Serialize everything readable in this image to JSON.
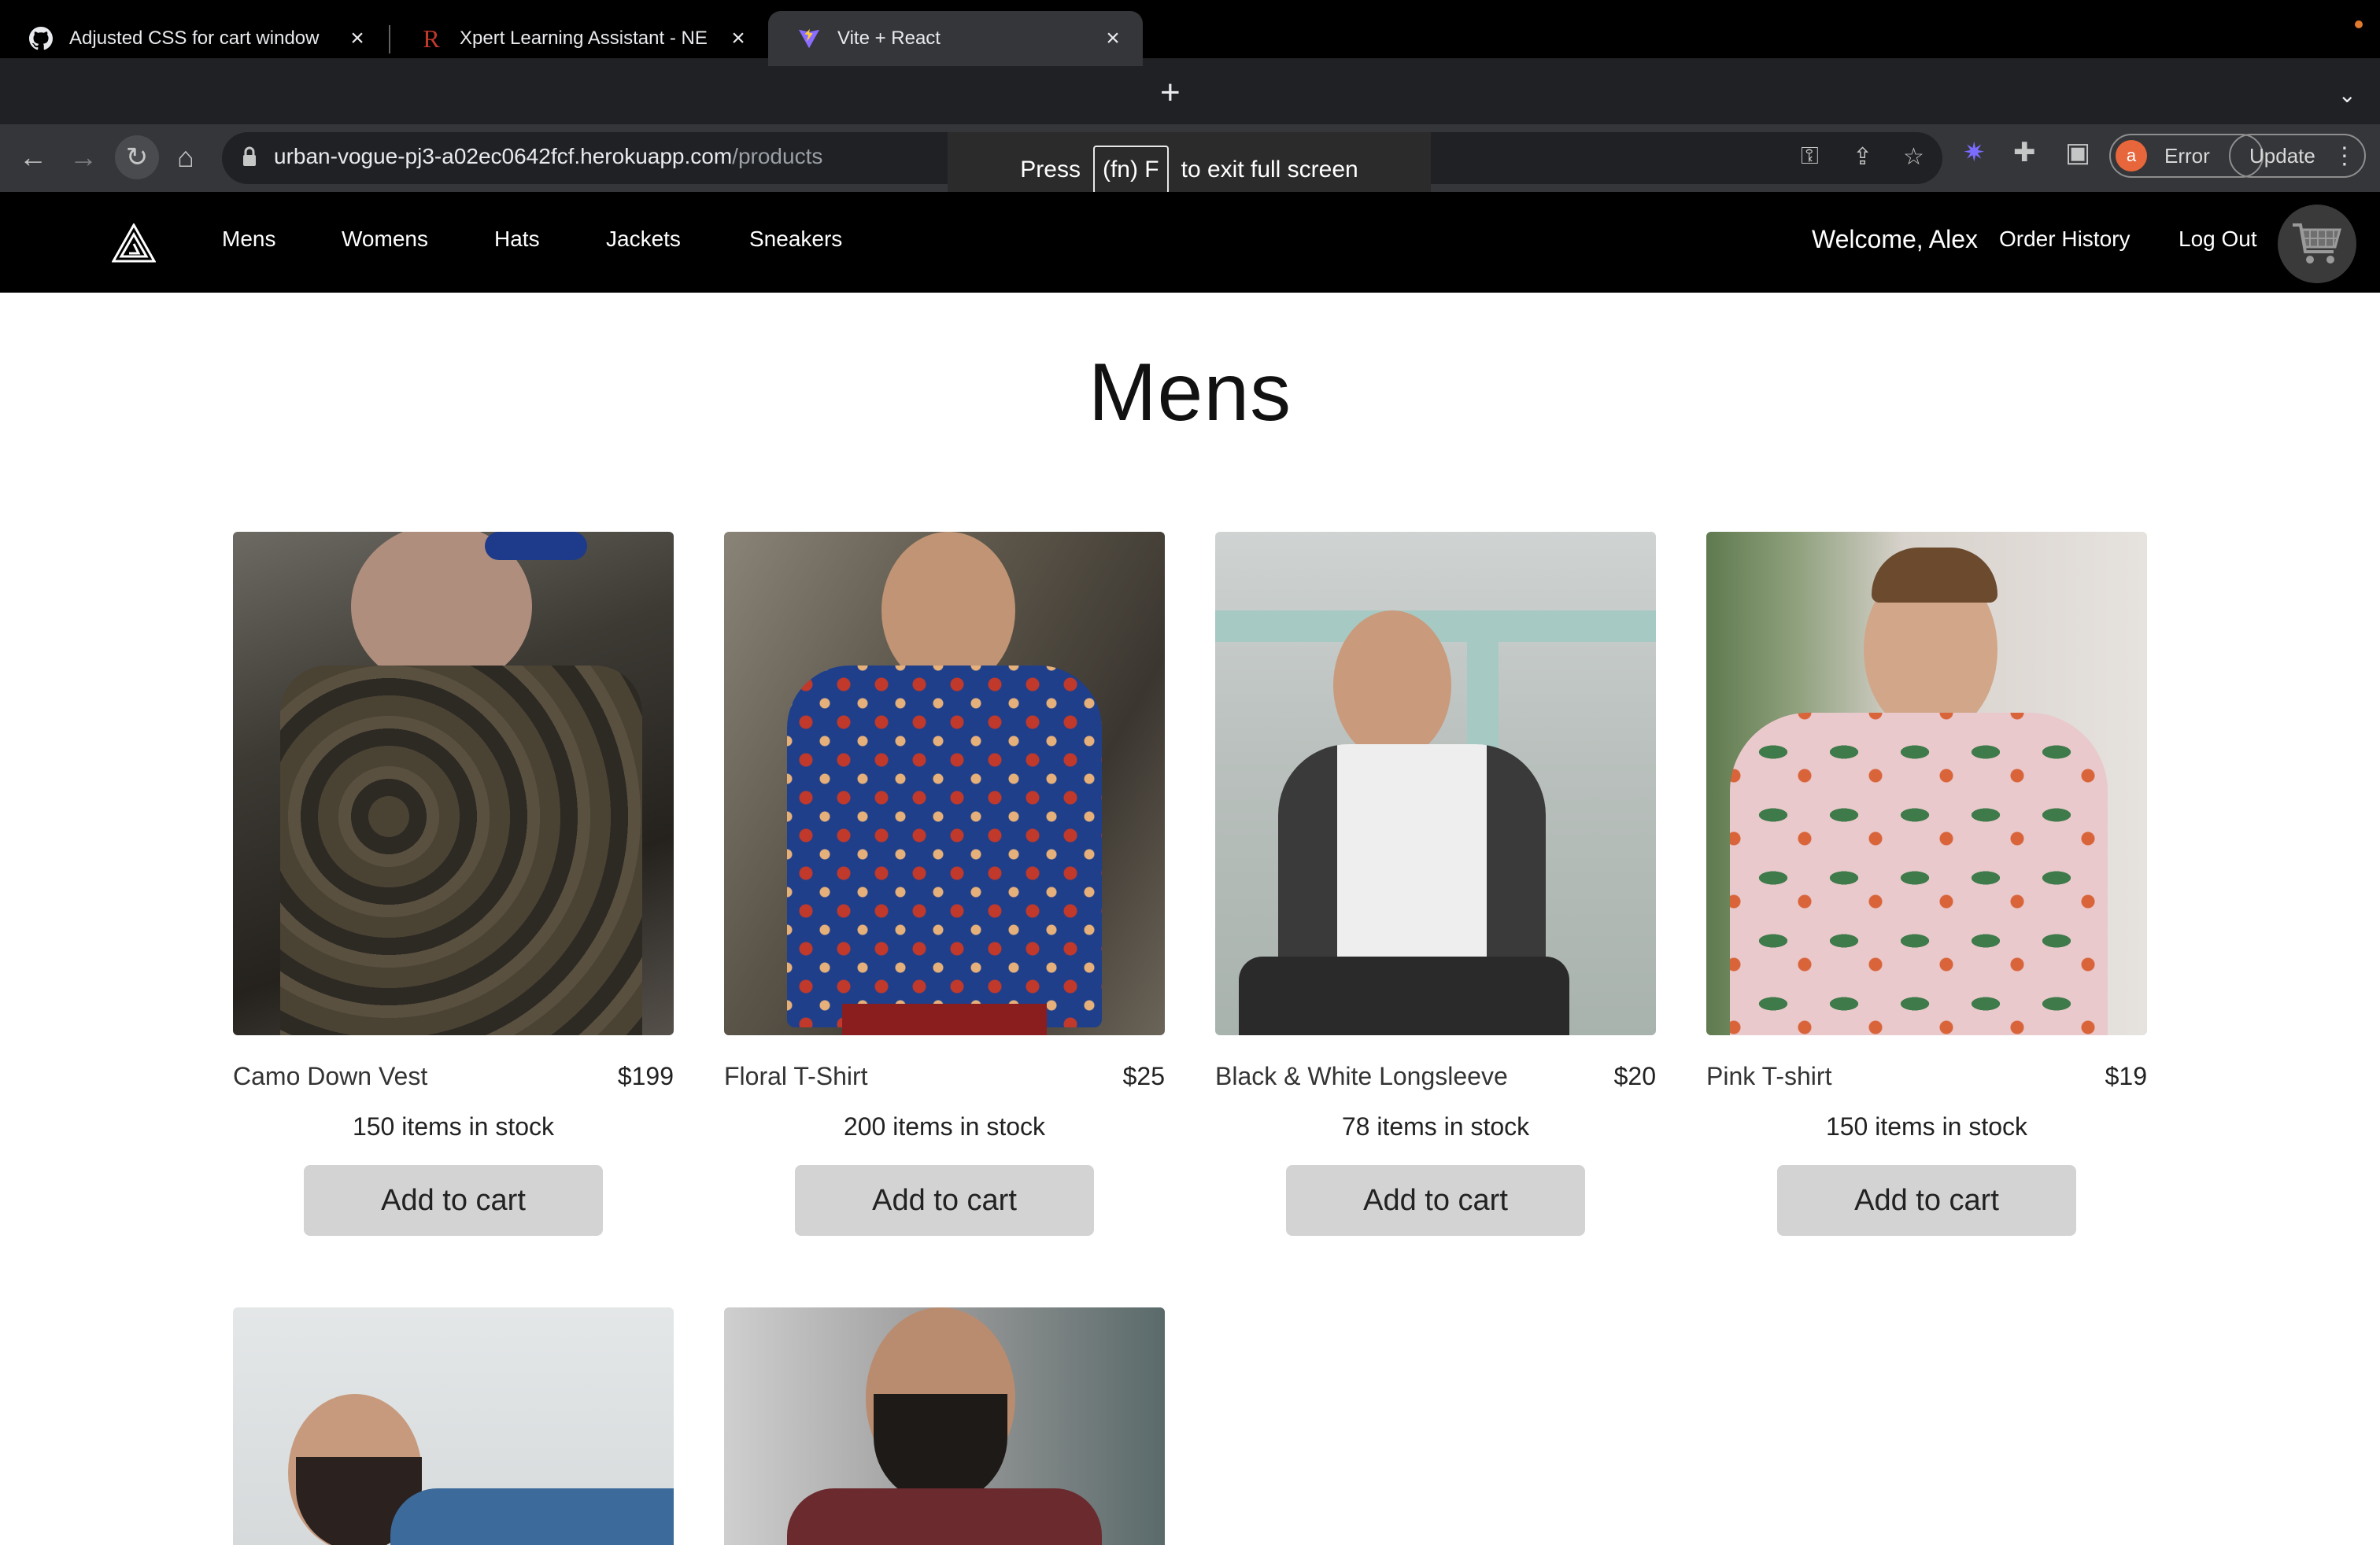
{
  "browser": {
    "tabs": [
      {
        "title": "Adjusted CSS for cart window",
        "favicon": "github-icon"
      },
      {
        "title": "Xpert Learning Assistant - NE",
        "favicon": "r-logo-icon"
      },
      {
        "title": "Vite + React",
        "favicon": "vite-icon"
      }
    ],
    "new_tab": "+",
    "url_host": "urban-vogue-pj3-a02ec0642fcf.herokuapp.com",
    "url_path": "/products",
    "profile_initial": "a",
    "profile_status": "Error",
    "update_label": "Update",
    "fullscreen_toast": {
      "prefix": "Press",
      "key": "(fn) F",
      "suffix": "to exit full screen"
    }
  },
  "nav": {
    "links": [
      "Mens",
      "Womens",
      "Hats",
      "Jackets",
      "Sneakers"
    ],
    "welcome": "Welcome, Alex",
    "order_history": "Order History",
    "logout": "Log Out"
  },
  "page": {
    "title": "Mens",
    "add_to_cart_label": "Add to cart",
    "products": [
      {
        "name": "Camo Down Vest",
        "price": "$199",
        "stock": "150 items in stock"
      },
      {
        "name": "Floral T-Shirt",
        "price": "$25",
        "stock": "200 items in stock"
      },
      {
        "name": "Black & White Longsleeve",
        "price": "$20",
        "stock": "78 items in stock"
      },
      {
        "name": "Pink T-shirt",
        "price": "$19",
        "stock": "150 items in stock"
      }
    ]
  },
  "colors": {
    "navbar_bg": "#000000",
    "button_bg": "#d3d3d3",
    "browser_chrome": "#35363a"
  }
}
